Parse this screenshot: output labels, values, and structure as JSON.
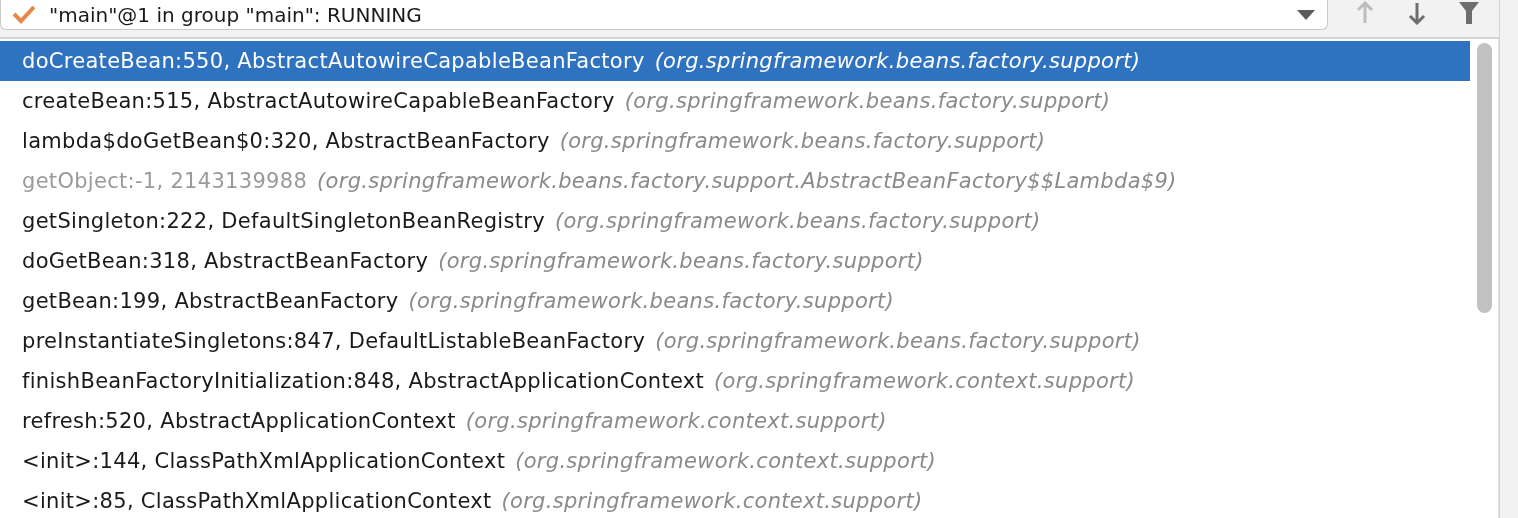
{
  "thread_selector": {
    "value": "\"main\"@1 in group \"main\": RUNNING",
    "paused": false
  },
  "toolbar": [
    {
      "kind": "up",
      "disabled": true
    },
    {
      "kind": "down",
      "disabled": false
    },
    {
      "kind": "filter",
      "disabled": false
    }
  ],
  "frames": [
    {
      "method": "doCreateBean:550, AbstractAutowireCapableBeanFactory",
      "package": "(org.springframework.beans.factory.support)",
      "selected": true,
      "library": false
    },
    {
      "method": "createBean:515, AbstractAutowireCapableBeanFactory",
      "package": "(org.springframework.beans.factory.support)",
      "selected": false,
      "library": false
    },
    {
      "method": "lambda$doGetBean$0:320, AbstractBeanFactory",
      "package": "(org.springframework.beans.factory.support)",
      "selected": false,
      "library": false
    },
    {
      "method": "getObject:-1, 2143139988",
      "package": "(org.springframework.beans.factory.support.AbstractBeanFactory$$Lambda$9)",
      "selected": false,
      "library": true
    },
    {
      "method": "getSingleton:222, DefaultSingletonBeanRegistry",
      "package": "(org.springframework.beans.factory.support)",
      "selected": false,
      "library": false
    },
    {
      "method": "doGetBean:318, AbstractBeanFactory",
      "package": "(org.springframework.beans.factory.support)",
      "selected": false,
      "library": false
    },
    {
      "method": "getBean:199, AbstractBeanFactory",
      "package": "(org.springframework.beans.factory.support)",
      "selected": false,
      "library": false
    },
    {
      "method": "preInstantiateSingletons:847, DefaultListableBeanFactory",
      "package": "(org.springframework.beans.factory.support)",
      "selected": false,
      "library": false
    },
    {
      "method": "finishBeanFactoryInitialization:848, AbstractApplicationContext",
      "package": "(org.springframework.context.support)",
      "selected": false,
      "library": false
    },
    {
      "method": "refresh:520, AbstractApplicationContext",
      "package": "(org.springframework.context.support)",
      "selected": false,
      "library": false
    },
    {
      "method": "<init>:144, ClassPathXmlApplicationContext",
      "package": "(org.springframework.context.support)",
      "selected": false,
      "library": false
    },
    {
      "method": "<init>:85, ClassPathXmlApplicationContext",
      "package": "(org.springframework.context.support)",
      "selected": false,
      "library": false
    }
  ]
}
